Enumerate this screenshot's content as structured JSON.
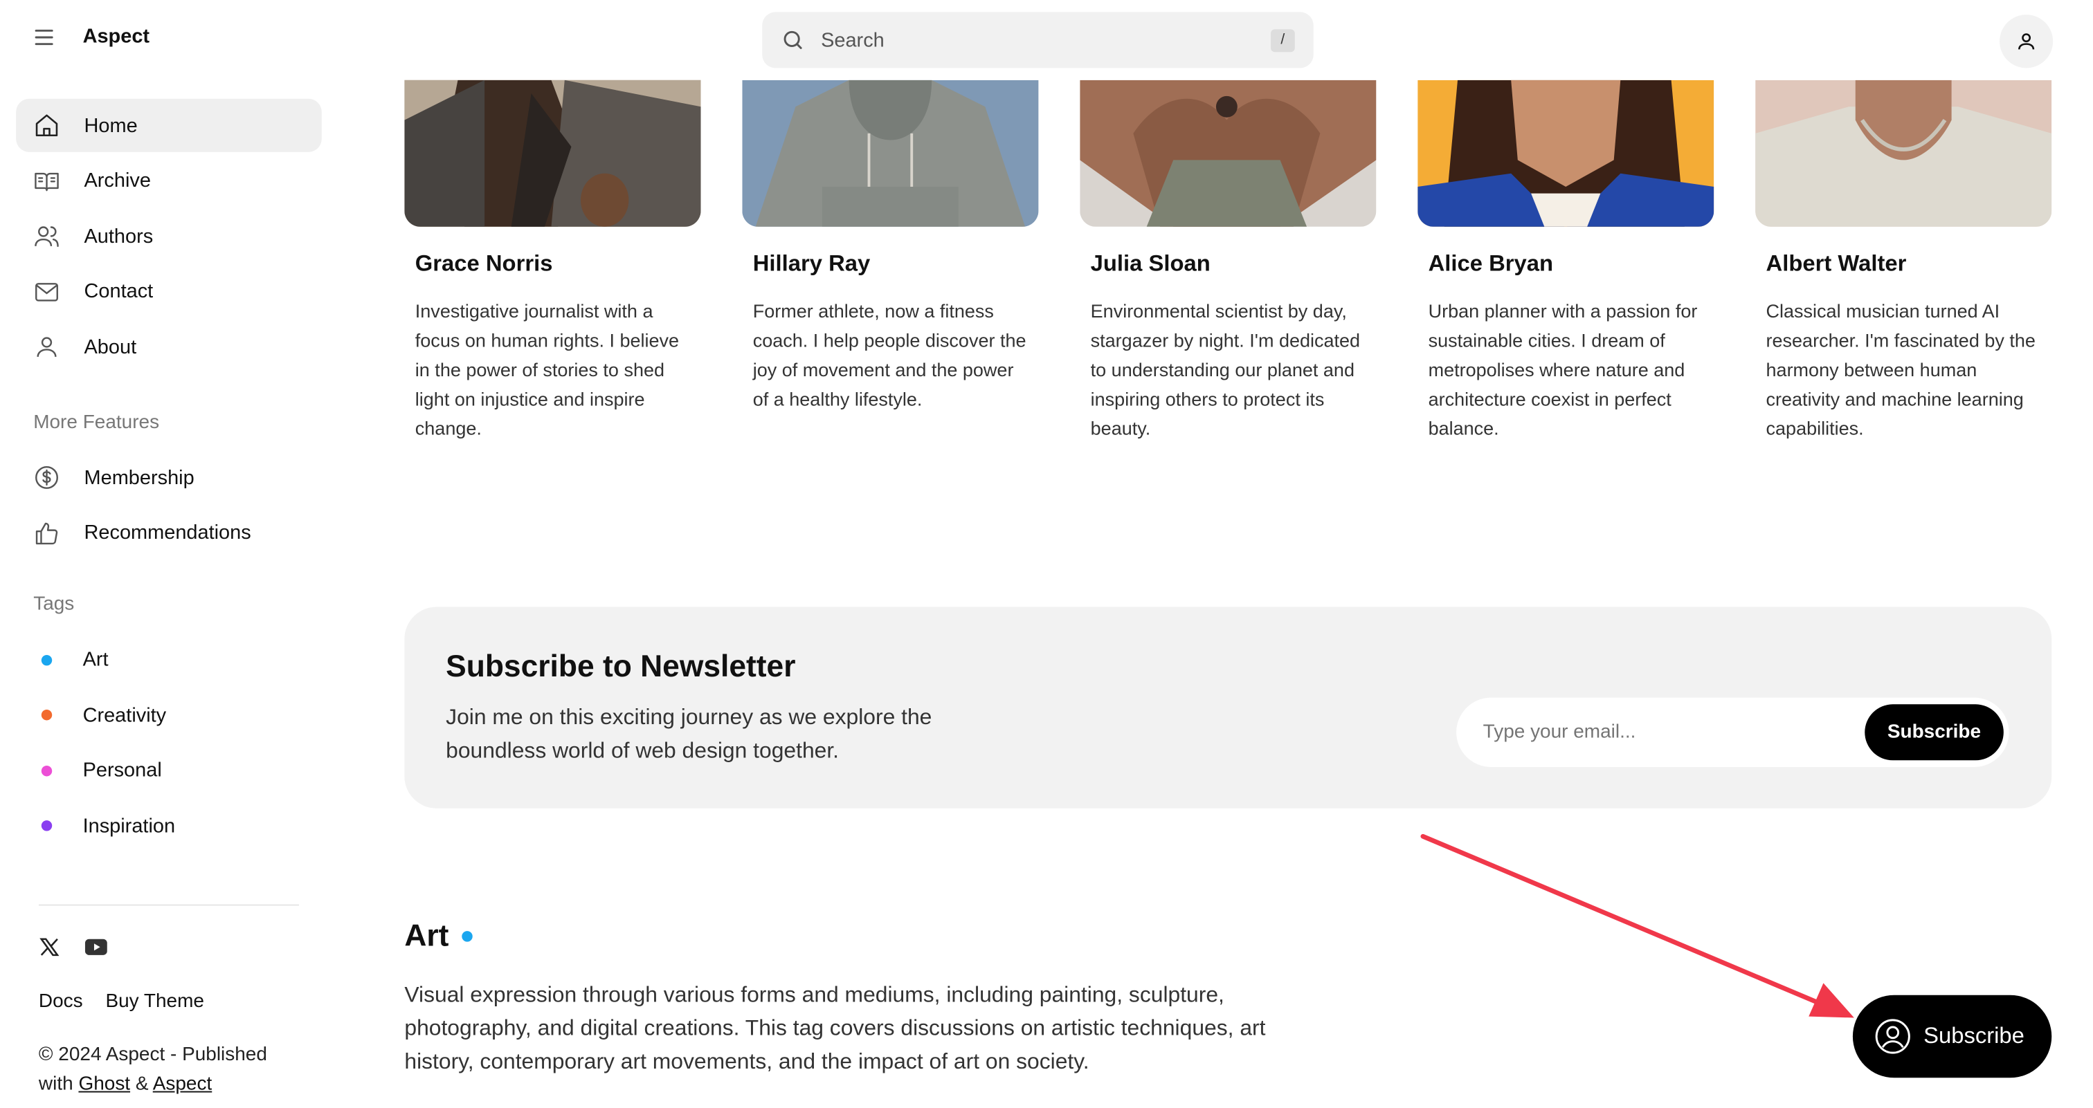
{
  "app": {
    "name": "Aspect"
  },
  "search": {
    "placeholder": "Search",
    "shortcut": "/"
  },
  "sidebar": {
    "nav": [
      {
        "label": "Home",
        "icon": "home-icon",
        "active": true
      },
      {
        "label": "Archive",
        "icon": "book-open-icon"
      },
      {
        "label": "Authors",
        "icon": "users-icon"
      },
      {
        "label": "Contact",
        "icon": "mail-icon"
      },
      {
        "label": "About",
        "icon": "user-icon"
      }
    ],
    "more_features_label": "More Features",
    "features": [
      {
        "label": "Membership",
        "icon": "dollar-circle-icon"
      },
      {
        "label": "Recommendations",
        "icon": "thumbs-up-icon"
      }
    ],
    "tags_label": "Tags",
    "tags": [
      {
        "label": "Art",
        "color": "#1ba6ef"
      },
      {
        "label": "Creativity",
        "color": "#f26a2e"
      },
      {
        "label": "Personal",
        "color": "#ec4fd6"
      },
      {
        "label": "Inspiration",
        "color": "#8a3ff0"
      }
    ],
    "social": [
      "x-icon",
      "youtube-icon"
    ],
    "footer_links": [
      "Docs",
      "Buy Theme"
    ],
    "copyright_prefix": "© 2024 Aspect - Published with",
    "copyright_ghost": "Ghost",
    "copyright_amp": "&",
    "copyright_aspect": "Aspect"
  },
  "authors": [
    {
      "name": "Grace Norris",
      "bio": "Investigative journalist with a focus on human rights. I believe in the power of stories to shed light on injustice and inspire change."
    },
    {
      "name": "Hillary Ray",
      "bio": "Former athlete, now a fitness coach. I help people discover the joy of movement and the power of a healthy lifestyle."
    },
    {
      "name": "Julia Sloan",
      "bio": "Environmental scientist by day, stargazer by night. I'm dedicated to understanding our planet and inspiring others to protect its beauty."
    },
    {
      "name": "Alice Bryan",
      "bio": "Urban planner with a passion for sustainable cities. I dream of metropolises where nature and architecture coexist in perfect balance."
    },
    {
      "name": "Albert Walter",
      "bio": "Classical musician turned AI researcher. I'm fascinated by the harmony between human creativity and machine learning capabilities."
    }
  ],
  "newsletter": {
    "title": "Subscribe to Newsletter",
    "description": "Join me on this exciting journey as we explore the boundless world of web design together.",
    "email_placeholder": "Type your email...",
    "button": "Subscribe"
  },
  "tag_section": {
    "title": "Art",
    "color": "#1ba6ef",
    "description": "Visual expression through various forms and mediums, including painting, sculpture, photography, and digital creations. This tag covers discussions on artistic techniques, art history, contemporary art movements, and the impact of art on society."
  },
  "floating_subscribe": {
    "label": "Subscribe"
  },
  "annotation": {
    "color": "#f0384a"
  }
}
